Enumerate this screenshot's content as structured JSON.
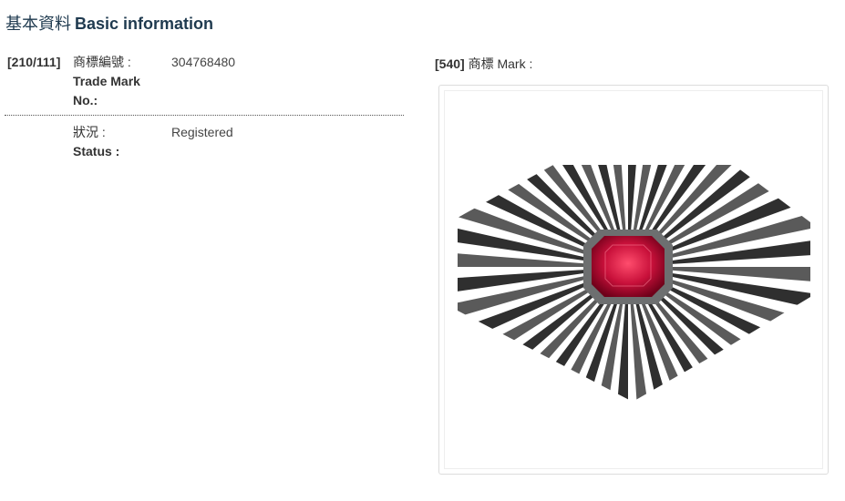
{
  "section": {
    "title_zh": "基本資料",
    "title_en": "Basic information"
  },
  "fields": [
    {
      "code": "[210/111]",
      "label_zh": "商標編號 :",
      "label_en": "Trade Mark No.:",
      "value": "304768480"
    },
    {
      "code": "",
      "label_zh": "狀況 :",
      "label_en": "Status :",
      "value": "Registered"
    }
  ],
  "mark": {
    "code": "[540]",
    "label": "商標 Mark :",
    "image_desc": "trademark-image-ruby-sunburst"
  },
  "colors": {
    "title": "#1f3a4f",
    "gem": "#c8103a",
    "ray": "#3a3a3a"
  }
}
